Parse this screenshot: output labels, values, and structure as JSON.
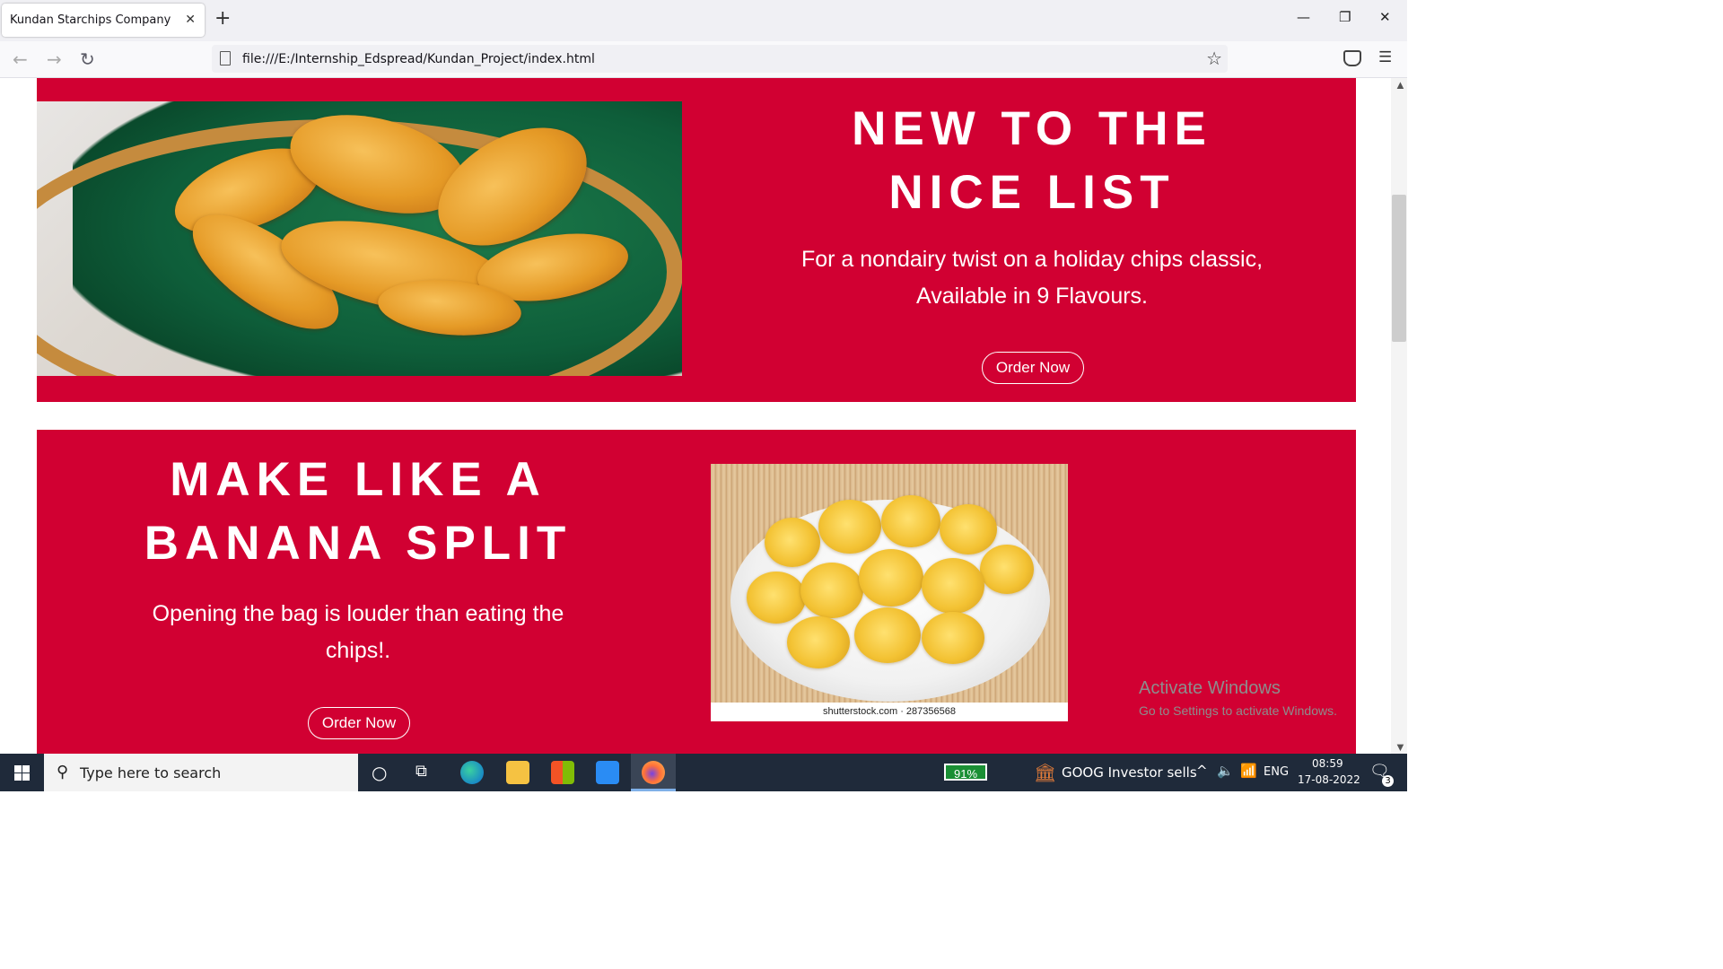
{
  "browser": {
    "tab_title": "Kundan Starchips Company",
    "url": "file:///E:/Internship_Edspread/Kundan_Project/index.html"
  },
  "section1": {
    "heading_line1": "NEW TO THE",
    "heading_line2": "NICE LIST",
    "desc_line1": "For a nondairy twist on a holiday chips classic,",
    "desc_line2": "Available in 9 Flavours.",
    "button_label": "Order Now"
  },
  "section2": {
    "heading_line1": "MAKE LIKE A",
    "heading_line2": "BANANA SPLIT",
    "desc_line1": "Opening the bag is louder than eating the",
    "desc_line2": "chips!.",
    "button_label": "Order Now",
    "image_caption": "shutterstock.com · 287356568"
  },
  "watermark": {
    "title": "Activate Windows",
    "subtitle": "Go to Settings to activate Windows."
  },
  "taskbar": {
    "search_placeholder": "Type here to search",
    "battery": "91%",
    "news": "GOOG  Investor sells",
    "lang": "ENG",
    "time": "08:59",
    "date": "17-08-2022",
    "notifications": "3"
  },
  "colors": {
    "section_bg": "#d10032",
    "taskbar_bg": "#1f2a3a"
  }
}
